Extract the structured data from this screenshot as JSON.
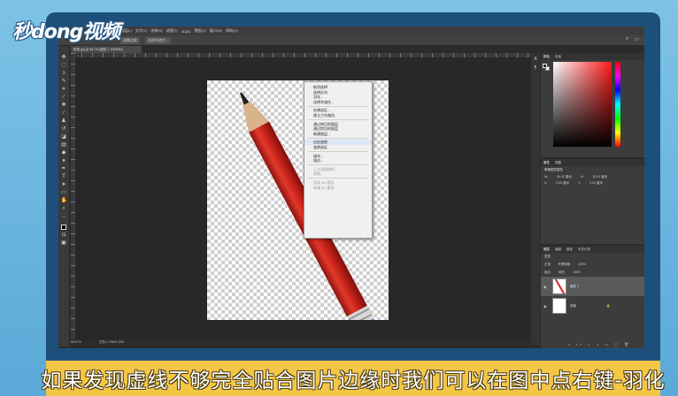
{
  "logo": {
    "text": "秒dong视频"
  },
  "menu": {
    "items": [
      "图层(L)",
      "文字(Y)",
      "选择(S)",
      "滤镜(T)",
      "3D(D)",
      "视图(V)",
      "窗口(W)",
      "帮助(H)"
    ]
  },
  "options": {
    "items": [
      "调整边缘",
      "选择并遮住..."
    ]
  },
  "document": {
    "tab_title": "铅笔.jpg @ 66.7% (图层 1, RGB/8#)",
    "zoom": "66.67%",
    "doc_info": "文档:1.29M/1.29M"
  },
  "context_menu": {
    "groups": [
      [
        "取消选择",
        "选择反向",
        "羽化...",
        "选择并遮住..."
      ],
      [
        "存储选区...",
        "建立工作路径..."
      ],
      [
        "通过拷贝的图层",
        "通过剪切的图层",
        "新建图层..."
      ],
      [
        "自由变换",
        "变换选区"
      ],
      [
        "填充...",
        "描边..."
      ],
      [
        "上次滤镜操作",
        "渐隐..."
      ],
      [
        "渲染 3D 图层",
        "新建 3D 模型"
      ]
    ],
    "disabled": [
      "上次滤镜操作",
      "渐隐...",
      "渲染 3D 图层",
      "新建 3D 模型"
    ],
    "hovered": "自由变换"
  },
  "panels": {
    "color_tabs": [
      "颜色",
      "色板"
    ],
    "properties_tabs": [
      "属性",
      "调整"
    ],
    "properties_title": "像素图层属性",
    "properties_rows": [
      [
        "W:",
        "30.42 厘米",
        "H:",
        "30.42 厘米"
      ],
      [
        "X:",
        "0.00 厘米",
        "Y:",
        "0.00 厘米"
      ]
    ],
    "layers_tabs": [
      "图层",
      "通道",
      "路径",
      "历史记录"
    ],
    "layer_kind": "类型",
    "blend_mode": "正常",
    "opacity_label": "不透明度:",
    "opacity": "100%",
    "lock_label": "锁定:",
    "fill_label": "填充:",
    "fill": "100%",
    "layers": [
      {
        "name": "图层 1",
        "selected": true
      },
      {
        "name": "背景",
        "selected": false
      }
    ]
  },
  "colors": {
    "subtitle_bg": "#f3c646",
    "frame": "#1e4f7a",
    "background": "#6fb8e0",
    "pencil": "#d8281e"
  },
  "subtitle": {
    "text": "如果发现虚线不够完全贴合图片边缘时我们可以在图中点右键-羽化"
  }
}
